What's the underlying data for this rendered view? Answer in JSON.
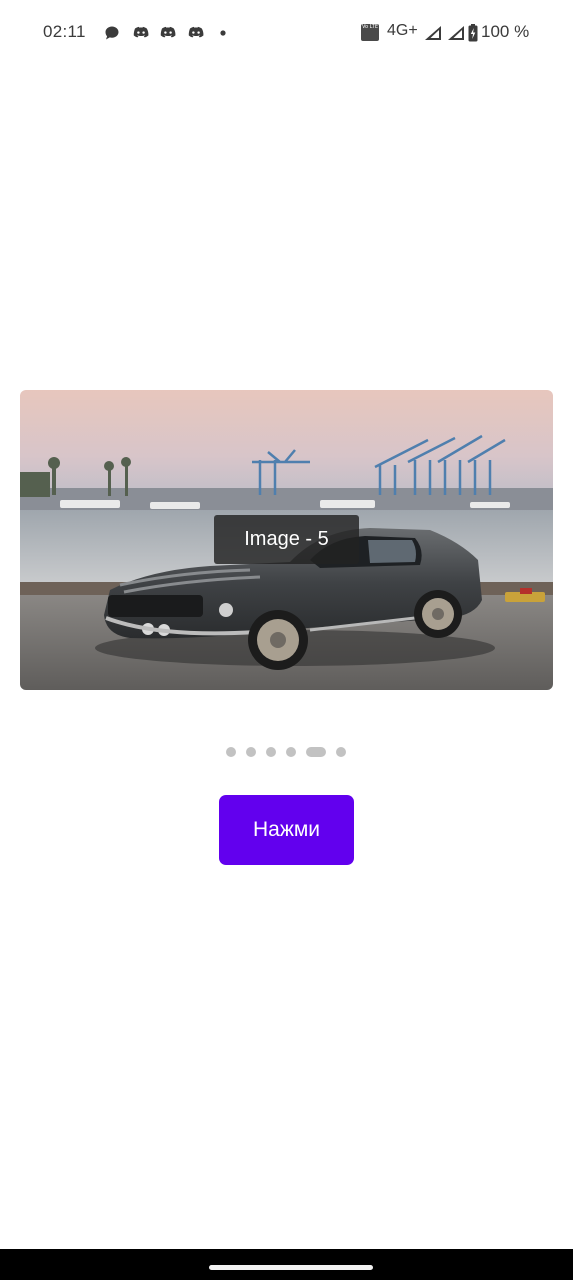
{
  "status_bar": {
    "time": "02:11",
    "notifications": [
      "chat-bubble-icon",
      "discord-icon",
      "discord-icon",
      "discord-icon",
      "more-dot-icon"
    ],
    "volte_label": "Vo LTE",
    "network": "4G+",
    "battery": "100 %"
  },
  "carousel": {
    "caption": "Image - 5",
    "image_description": "car-photo",
    "page_count": 6,
    "active_index": 4
  },
  "button": {
    "label": "Нажми"
  },
  "colors": {
    "accent": "#6200ee",
    "dot": "#c2c2c2",
    "nav_bar": "#000000"
  }
}
